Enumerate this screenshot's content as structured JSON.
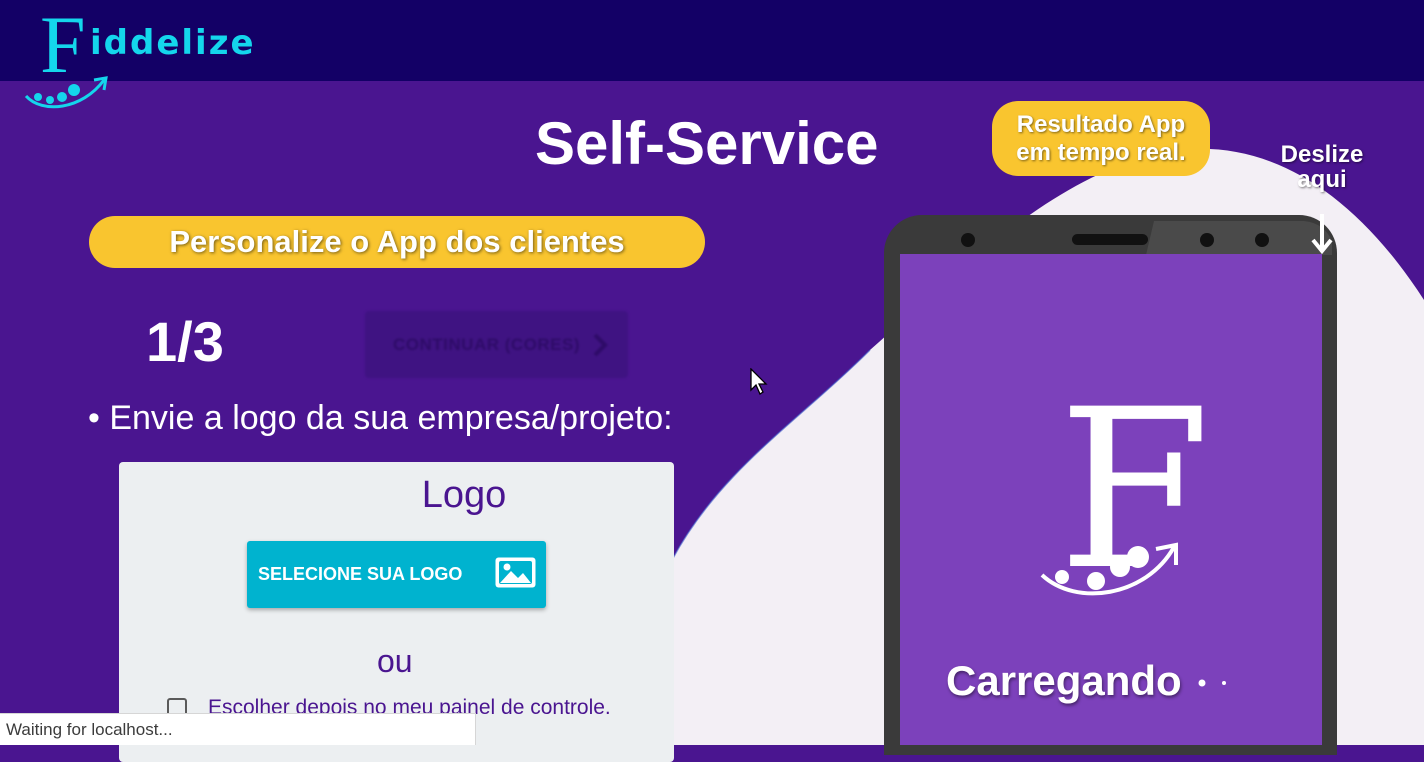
{
  "header": {
    "brand_initial": "F",
    "brand_rest": "iddelize",
    "brand_color": "#14d6ec",
    "bar_color": "#130066"
  },
  "hero": {
    "title": "Self-Service",
    "result_pill_line1": "Resultado App",
    "result_pill_line2": "em tempo real.",
    "swipe_line1": "Deslize",
    "swipe_line2": "aqui"
  },
  "wizard": {
    "heading": "Personalize o App dos clientes",
    "step": "1/3",
    "continue_label": "CONTINUAR (CORES)",
    "prompt": "• Envie a logo da sua empresa/projeto:",
    "card": {
      "title": "Logo",
      "select_button": "SELECIONE SUA LOGO",
      "or_text": "ou",
      "later_checkbox_label": "Escolher depois no meu painel de controle.",
      "later_checked": false
    }
  },
  "preview": {
    "brand_initial": "F",
    "loading_text": "Carregando",
    "screen_color": "#7c41bb"
  },
  "browser_status": "Waiting for localhost...",
  "colors": {
    "background": "#4a1590",
    "accent_yellow": "#f9c52f",
    "primary_button": "#00b3cf",
    "blob": "#f3eff5"
  }
}
